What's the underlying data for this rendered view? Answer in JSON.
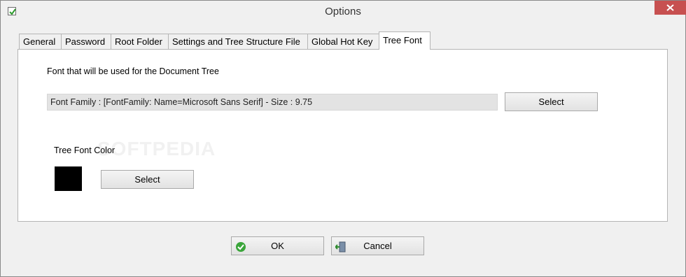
{
  "window": {
    "title": "Options"
  },
  "tabs": [
    {
      "label": "General"
    },
    {
      "label": "Password"
    },
    {
      "label": "Root Folder"
    },
    {
      "label": "Settings and Tree Structure File"
    },
    {
      "label": "Global Hot Key"
    },
    {
      "label": "Tree Font",
      "active": true
    }
  ],
  "tree_font": {
    "description": "Font that will be used for the Document Tree",
    "font_value": "Font Family : [FontFamily: Name=Microsoft Sans Serif] - Size : 9.75",
    "select_font_label": "Select",
    "color_label": "Tree Font Color",
    "color_value": "#000000",
    "select_color_label": "Select"
  },
  "footer": {
    "ok_label": "OK",
    "cancel_label": "Cancel"
  },
  "watermark": "SOFTPEDIA",
  "icons": {
    "app": "checkbox-icon",
    "close": "close-icon",
    "ok": "check-circle-icon",
    "cancel": "exit-door-icon"
  },
  "colors": {
    "close_button": "#c75050",
    "ok_icon": "#3aa53a"
  }
}
